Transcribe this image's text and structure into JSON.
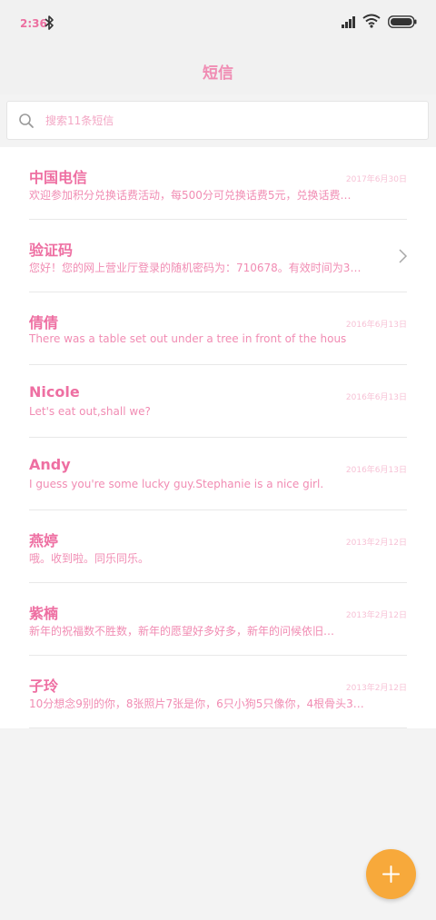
{
  "status_bar": {
    "time": "2:36"
  },
  "header": {
    "title": "短信"
  },
  "search": {
    "placeholder": "搜索11条短信"
  },
  "conversations": [
    {
      "name": "中国电信",
      "preview": "欢迎参加积分兑换话费活动，每500分可兑换话费5元，兑换话费…",
      "date": "2017年6月30日"
    },
    {
      "name": "验证码",
      "preview": "您好！您的网上营业厅登录的随机密码为：710678。有效时间为3…",
      "date": ""
    },
    {
      "name": "倩倩",
      "preview": "There was a table set out under a tree in front of the hous",
      "date": "2016年6月13日"
    },
    {
      "name": "Nicole",
      "preview": "Let's eat out,shall we?",
      "date": "2016年6月13日"
    },
    {
      "name": "Andy",
      "preview": "I guess you're some lucky guy.Stephanie is a nice girl.",
      "date": "2016年6月13日"
    },
    {
      "name": "燕婷",
      "preview": "哦。收到啦。同乐同乐。",
      "date": "2013年2月12日"
    },
    {
      "name": "紫楠",
      "preview": "新年的祝福数不胜数，新年的愿望好多好多，新年的问候依旧…",
      "date": "2013年2月12日"
    },
    {
      "name": "子玲",
      "preview": "10分想念9别的你，8张照片7张是你，6只小狗5只像你，4根骨头3…",
      "date": "2013年2月12日"
    }
  ],
  "colors": {
    "accent_pink": "#ee6fa2",
    "fab": "#f7a93b"
  }
}
